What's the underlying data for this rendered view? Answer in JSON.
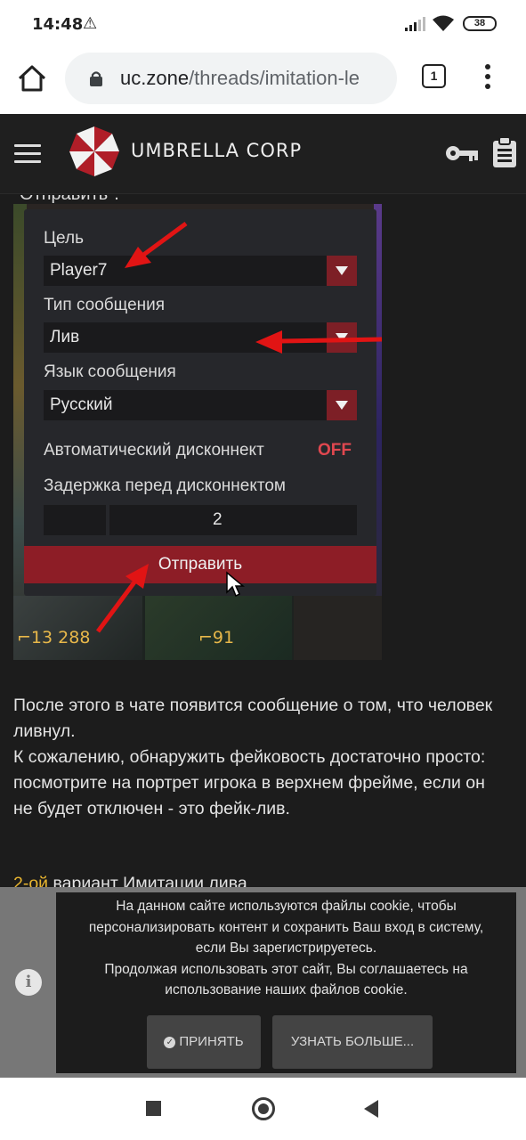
{
  "status_bar": {
    "time": "14:48",
    "battery": "38"
  },
  "browser": {
    "url_host": "uc.zone",
    "url_path": "/threads/imitation-le",
    "tab_count": "1"
  },
  "site": {
    "brand": "UMBRELLA CORP"
  },
  "content": {
    "partial_top": "Отправить\".",
    "game_panel": {
      "target_label": "Цель",
      "target_value": "Player7",
      "type_label": "Тип сообщения",
      "type_value": "Лив",
      "lang_label": "Язык сообщения",
      "lang_value": "Русский",
      "autodisconnect_label": "Автоматический дисконнект",
      "autodisconnect_value": "OFF",
      "delay_label": "Задержка перед дисконнектом",
      "delay_value": "2",
      "send_label": "Отправить",
      "gold_left": "13 288",
      "gold_right": "91"
    },
    "paragraph": [
      "После этого в чате появится сообщение о том, что человек",
      "ливнул.",
      "К сожалению, обнаружить фейковость достаточно просто:",
      "посмотрите на портрет игрока в верхнем фрейме, если он",
      "не будет отключен - это фейк-лив."
    ],
    "partial_bottom_hl": "2-ой",
    "partial_bottom_text": " вариант Имитации лива"
  },
  "cookie": {
    "lines": [
      "На данном сайте используются файлы cookie, чтобы",
      "персонализировать контент и сохранить Ваш вход в систему,",
      "если Вы зарегистрируетесь.",
      "Продолжая использовать этот сайт, Вы соглашаетесь на",
      "использование наших файлов cookie."
    ],
    "accept_label": "ПРИНЯТЬ",
    "more_label": "УЗНАТЬ БОЛЬШЕ..."
  },
  "colors": {
    "accent_red": "#8d1d26",
    "highlight": "#e8b530"
  }
}
